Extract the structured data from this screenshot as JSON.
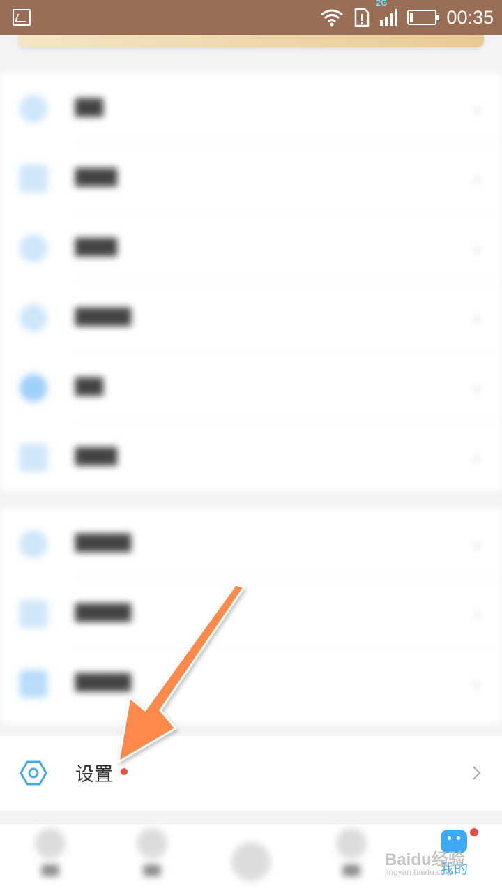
{
  "status_bar": {
    "network_type": "2G",
    "time": "00:35"
  },
  "settings_row": {
    "label": "设置",
    "icon": "hexagon-settings-icon",
    "has_badge": true
  },
  "bottom_nav": {
    "mine_label": "我的"
  },
  "watermark": {
    "brand": "Baidu经验",
    "url": "jingyan.baidu.com"
  },
  "colors": {
    "status_bar": "#9a6d55",
    "accent": "#3fa9f5",
    "badge": "#e74c3c",
    "arrow": "#ff8a4c"
  }
}
